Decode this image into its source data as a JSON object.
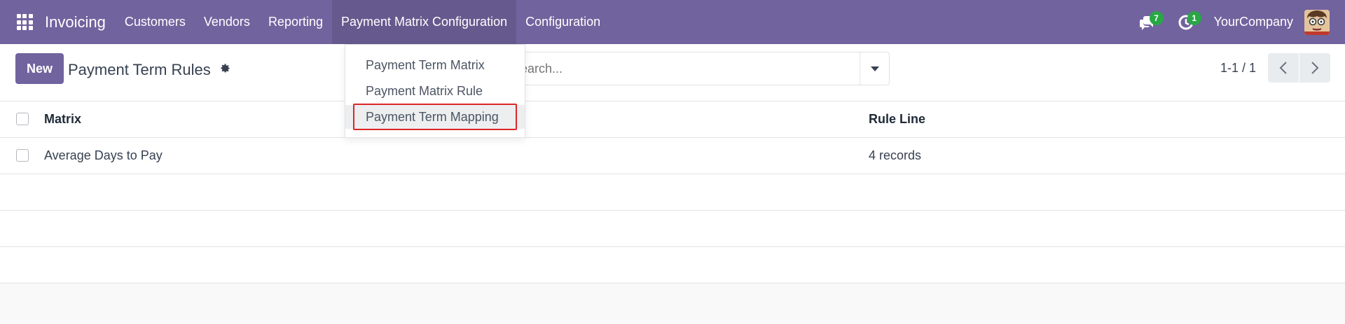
{
  "navbar": {
    "brand": "Invoicing",
    "menu": [
      {
        "label": "Customers"
      },
      {
        "label": "Vendors"
      },
      {
        "label": "Reporting"
      },
      {
        "label": "Payment Matrix Configuration"
      },
      {
        "label": "Configuration"
      }
    ],
    "messages_count": "7",
    "activities_count": "1",
    "company": "YourCompany"
  },
  "control": {
    "new_label": "New",
    "title": "Payment Term Rules",
    "search_placeholder": "Search...",
    "pager": "1-1 / 1"
  },
  "dropdown": {
    "items": [
      {
        "label": "Payment Term Matrix"
      },
      {
        "label": "Payment Matrix Rule"
      },
      {
        "label": "Payment Term Mapping"
      }
    ]
  },
  "list": {
    "columns": [
      "Matrix",
      "Rule Line"
    ],
    "rows": [
      {
        "matrix": "Average Days to Pay",
        "rule_line": "4 records"
      }
    ]
  },
  "colors": {
    "navbar": "#71639e",
    "primary_button": "#71639e",
    "badge": "#28a745",
    "highlight": "#dc2626"
  }
}
